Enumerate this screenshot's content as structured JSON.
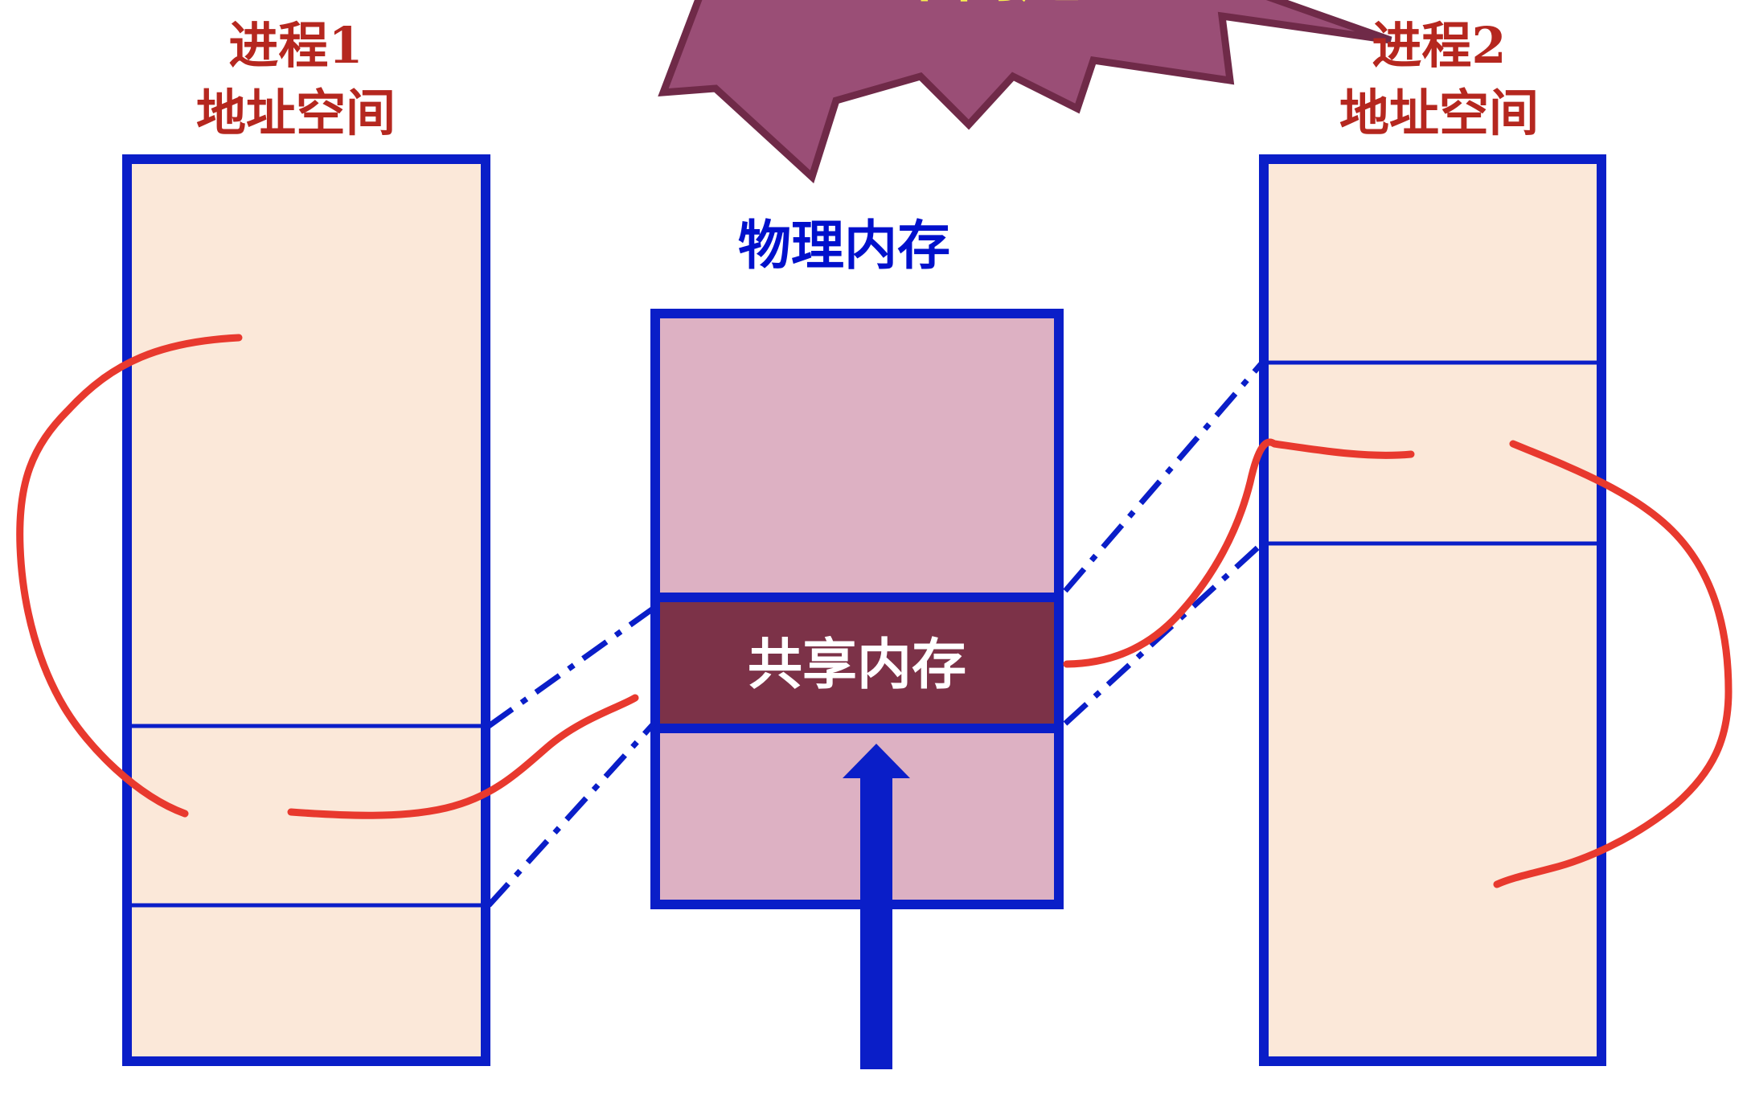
{
  "process1": {
    "title_line1": "进程1",
    "title_line2": "地址空间"
  },
  "process2": {
    "title_line1": "进程2",
    "title_line2": "地址空间"
  },
  "physical_memory": {
    "title": "物理内存"
  },
  "shared_memory": {
    "label": "共享内存"
  },
  "burst": {
    "text": "个问题!"
  },
  "colors": {
    "address_space_fill": "#fbe8d9",
    "physical_memory_fill": "#ddb1c3",
    "shared_block_fill": "#7c3248",
    "border_blue": "#0a1ec8",
    "annotation_red": "#e8392e",
    "burst_fill": "#9a4e76",
    "burst_text": "#f7ef4f",
    "title_red": "#b5271f",
    "title_blue": "#0010cc"
  }
}
